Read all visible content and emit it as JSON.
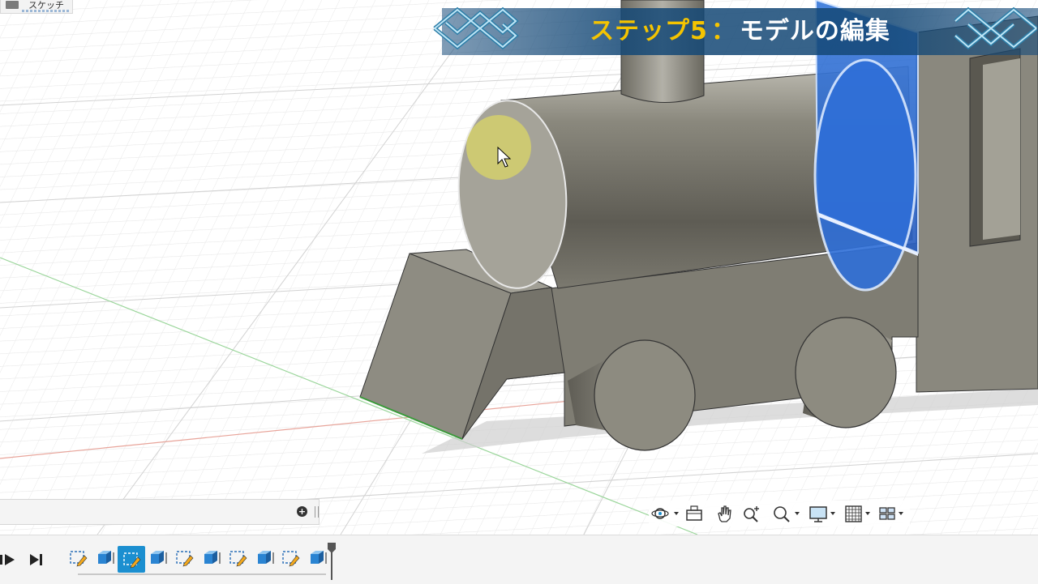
{
  "banner": {
    "step": "ステップ5",
    "separator": "：",
    "title": "モデルの編集"
  },
  "sketch_tag": {
    "label": "スケッチ"
  },
  "browser": {
    "add_icon": "plus-circle-icon",
    "resize_icon": "grip-icon"
  },
  "navigation_bar": {
    "tools": [
      {
        "name": "orbit-icon",
        "has_dropdown": true
      },
      {
        "name": "look-at-icon",
        "has_dropdown": false
      },
      {
        "name": "pan-icon",
        "has_dropdown": false
      },
      {
        "name": "zoom-icon",
        "has_dropdown": false
      },
      {
        "name": "fit-icon",
        "has_dropdown": true
      },
      {
        "name": "display-settings-icon",
        "has_dropdown": true
      },
      {
        "name": "grid-settings-icon",
        "has_dropdown": true
      },
      {
        "name": "viewports-icon",
        "has_dropdown": true
      }
    ]
  },
  "timeline": {
    "controls": [
      "play-icon",
      "step-forward-end-icon"
    ],
    "features": [
      {
        "name": "sketch-feature-icon",
        "active": false
      },
      {
        "name": "extrude-feature-icon",
        "active": false
      },
      {
        "name": "sketch-feature-icon",
        "active": true
      },
      {
        "name": "extrude-feature-icon",
        "active": false
      },
      {
        "name": "sketch-feature-icon",
        "active": false
      },
      {
        "name": "extrude-feature-icon",
        "active": false
      },
      {
        "name": "sketch-feature-icon",
        "active": false
      },
      {
        "name": "extrude-feature-icon",
        "active": false
      },
      {
        "name": "sketch-feature-icon",
        "active": false
      },
      {
        "name": "extrude-feature-icon",
        "active": false
      }
    ]
  },
  "colors": {
    "model": "#8d8b80",
    "selection": "#2f6fd8",
    "accent": "#1b8fd0",
    "banner_step": "#f5c400",
    "banner_bg": "#174b7a"
  },
  "cursor_icon": "arrow-cursor-icon"
}
